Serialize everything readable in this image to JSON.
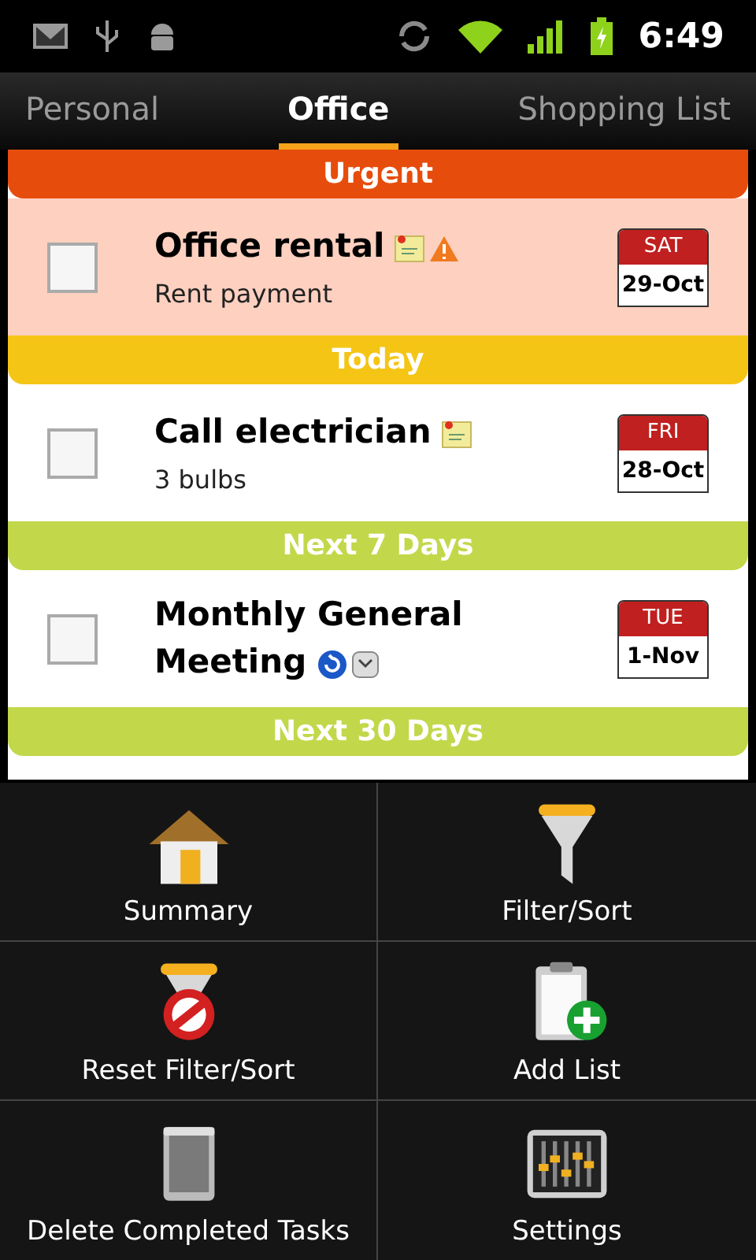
{
  "status_bar": {
    "time": "6:49"
  },
  "tabs": [
    {
      "label": "Personal",
      "selected": false
    },
    {
      "label": "Office",
      "selected": true
    },
    {
      "label": "Shopping List",
      "selected": false
    }
  ],
  "sections": [
    {
      "title": "Urgent",
      "color": "#e64d0c",
      "tasks": [
        {
          "title": "Office rental",
          "note": "Rent payment",
          "checked": false,
          "highlighted": true,
          "has_note": true,
          "alert": true,
          "repeating": false,
          "reminder": false,
          "day": "SAT",
          "date": "29-Oct"
        }
      ]
    },
    {
      "title": "Today",
      "color": "#f5c516",
      "tasks": [
        {
          "title": "Call electrician",
          "note": "3 bulbs",
          "checked": false,
          "highlighted": false,
          "has_note": true,
          "alert": false,
          "repeating": false,
          "reminder": false,
          "day": "FRI",
          "date": "28-Oct"
        }
      ]
    },
    {
      "title": "Next 7 Days",
      "color": "#c2d84a",
      "tasks": [
        {
          "title": "Monthly General Meeting",
          "checked": false,
          "highlighted": false,
          "has_note": false,
          "alert": false,
          "repeating": true,
          "reminder": true,
          "day": "TUE",
          "date": "1-Nov"
        }
      ]
    },
    {
      "title": "Next 30 Days",
      "color": "#c2d84a"
    }
  ],
  "menu": [
    {
      "kind": "summary",
      "label": "Summary"
    },
    {
      "kind": "filter",
      "label": "Filter/Sort"
    },
    {
      "kind": "reset",
      "label": "Reset Filter/Sort"
    },
    {
      "kind": "add_list",
      "label": "Add List"
    },
    {
      "kind": "delete",
      "label": "Delete Completed Tasks"
    },
    {
      "kind": "settings",
      "label": "Settings"
    }
  ]
}
